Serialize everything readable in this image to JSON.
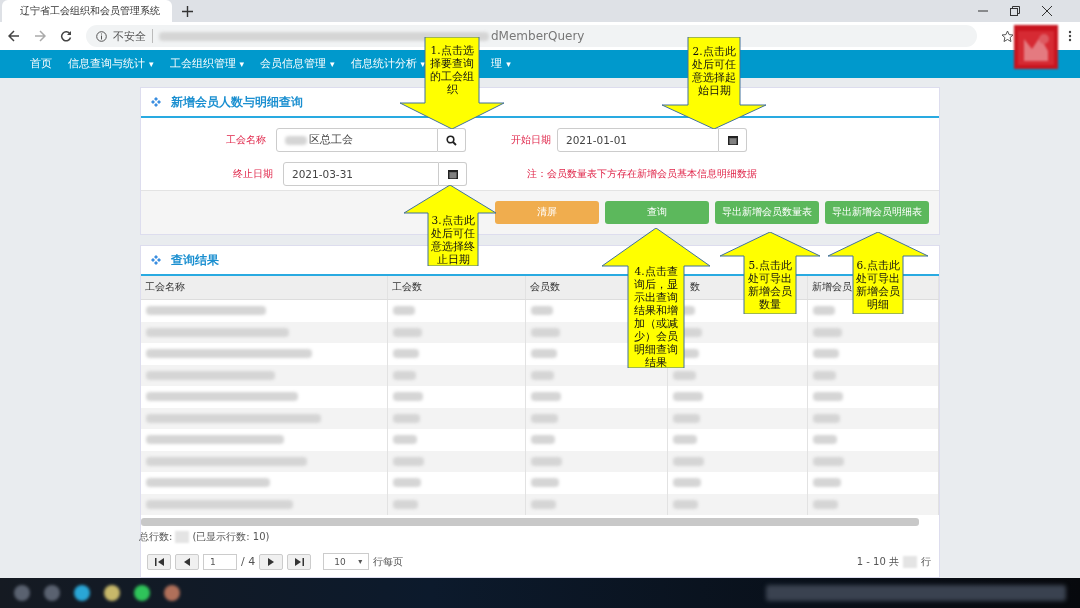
{
  "browser": {
    "tab_title": "辽宁省工会组织和会员管理系统",
    "security": "不安全",
    "url_tail": "dMemberQuery"
  },
  "nav": [
    {
      "label": "首页"
    },
    {
      "label": "信息查询与统计",
      "caret": "▾"
    },
    {
      "label": "工会组织管理",
      "caret": "▾"
    },
    {
      "label": "会员信息管理",
      "caret": "▾"
    },
    {
      "label": "信息统计分析",
      "caret": "▾"
    },
    {
      "label": "理",
      "caret": "▾"
    }
  ],
  "query_panel": {
    "title": "新增会员人数与明细查询",
    "union_label": "工会名称",
    "union_value": "区总工会",
    "start_label": "开始日期",
    "start_value": "2021-01-01",
    "end_label": "终止日期",
    "end_value": "2021-03-31",
    "note": "注：会员数量表下方存在新增会员基本信息明细数据",
    "buttons": [
      {
        "label": "清屏",
        "kind": "warning"
      },
      {
        "label": "查询",
        "kind": "success"
      },
      {
        "label": "导出新增会员数量表",
        "kind": "success"
      },
      {
        "label": "导出新增会员明细表",
        "kind": "success"
      }
    ]
  },
  "results": {
    "title": "查询结果",
    "columns": [
      "工会名称",
      "工会数",
      "会员数",
      "数",
      "新增会员"
    ],
    "rows": [
      {
        "kind": "redacted"
      },
      {
        "kind": "redacted"
      },
      {
        "kind": "redacted"
      },
      {
        "kind": "redacted"
      },
      {
        "kind": "redacted"
      },
      {
        "kind": "redacted"
      },
      {
        "kind": "redacted"
      },
      {
        "kind": "redacted"
      },
      {
        "kind": "redacted"
      },
      {
        "kind": "redacted"
      }
    ],
    "total_label": "总行数:",
    "shown": "(已显示行数:  10)",
    "page": "1",
    "page_total": "/ 4",
    "page_size": "10",
    "page_size_caret": "▾",
    "per_page": "行每页",
    "range": "1 - 10 共",
    "range_unit": "行"
  },
  "callouts": [
    {
      "kind": "down",
      "text": "1.点击选择要查询的工会组织"
    },
    {
      "kind": "down",
      "text": "2.点击此处后可任意选择起始日期"
    },
    {
      "kind": "up",
      "text": "3.点击此处后可任意选择终止日期"
    },
    {
      "kind": "up",
      "text": "4.点击查询后，显示出查询结果和增加（或减少）会员明细查询结果"
    },
    {
      "kind": "up",
      "text": "5.点击此处可导出新增会员数量"
    },
    {
      "kind": "up",
      "text": "6.点击此处可导出新增会员明细"
    }
  ]
}
